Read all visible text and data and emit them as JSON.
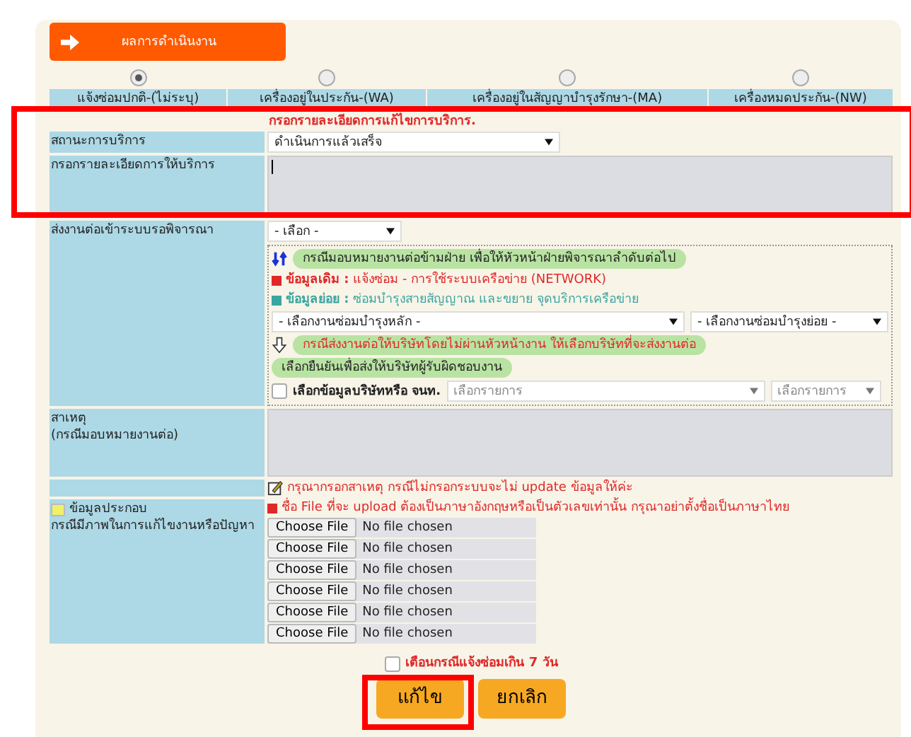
{
  "header_tab": {
    "label": "ผลการดำเนินงาน"
  },
  "service_types": [
    {
      "label": "แจ้งซ่อมปกติ-(ไม่ระบุ)",
      "selected": true
    },
    {
      "label": "เครื่องอยู่ในประกัน-(WA)",
      "selected": false
    },
    {
      "label": "เครื่องอยู่ในสัญญาบำรุงรักษา-(MA)",
      "selected": false
    },
    {
      "label": "เครื่องหมดประกัน-(NW)",
      "selected": false
    }
  ],
  "service_detail": {
    "highlighted": true,
    "title": "กรอกรายละเอียดการแก้ไขการบริการ.",
    "status_label": "สถานะการบริการ",
    "status_value": "ดำเนินการแล้วเสร็จ",
    "details_label": "กรอกรายละเอียดการให้บริการ"
  },
  "forward": {
    "label": "ส่งงานต่อเข้าระบบรอพิจารณา",
    "select": "- เลือก -",
    "transfer_note": "กรณีมอบหมายงานต่อข้ามฝ่าย เพื่อให้หัวหน้าฝ่ายพิจารณาลำดับต่อไป",
    "info": [
      {
        "label": "ข้อมูลเดิม :",
        "value": "แจ้งซ่อม - การใช้ระบบเครือข่าย (NETWORK)",
        "color": "#e02828"
      },
      {
        "label": "ข้อมูลย่อย :",
        "value": "ซ่อมบำรุงสายสัญญาณ และขยาย จุดบริการเครือข่าย",
        "color": "#3aa6a0"
      }
    ],
    "main_select": "- เลือกงานซ่อมบำรุงหลัก -",
    "sub_select": "- เลือกงานซ่อมบำรุงย่อย -",
    "company_note": "กรณีส่งงานต่อให้บริษัทโดยไม่ผ่านหัวหน้างาน ให้เลือกบริษัทที่จะส่งงานต่อ",
    "confirm_note": "เลือกยืนยันเพื่อส่งให้บริษัทผู้รับผิดชอบงาน",
    "company_checkbox": {
      "label": "เลือกข้อมูลบริษัทหรือ จนท.",
      "checked": false
    },
    "company_select": {
      "placeholder": "เลือกรายการ"
    },
    "item_select": {
      "placeholder": "เลือกรายการ"
    }
  },
  "reason": {
    "label": "สาเหตุ",
    "sublabel": "(กรณีมอบหมายงานต่อ)",
    "note": "กรุณากรอกสาเหตุ กรณีไม่กรอกระบบจะไม่ update ข้อมูลให้ค่ะ"
  },
  "attachments": {
    "label": "ข้อมูลประกอบ",
    "sublabel": "กรณีมีภาพในการแก้ไขงานหรือปัญหา",
    "note": "ชื่อ File ที่จะ upload ต้องเป็นภาษาอังกฤษหรือเป็นตัวเลขเท่านั้น กรุณาอย่าตั้งชื่อเป็นภาษาไทย",
    "files": [
      {
        "button": "Choose File",
        "status": "No file chosen"
      },
      {
        "button": "Choose File",
        "status": "No file chosen"
      },
      {
        "button": "Choose File",
        "status": "No file chosen"
      },
      {
        "button": "Choose File",
        "status": "No file chosen"
      },
      {
        "button": "Choose File",
        "status": "No file chosen"
      },
      {
        "button": "Choose File",
        "status": "No file chosen"
      }
    ]
  },
  "overdue_warning": {
    "label": "เตือนกรณีแจ้งซ่อมเกิน 7 วัน",
    "checked": false
  },
  "buttons": [
    {
      "label": "แก้ไข",
      "highlighted": true
    },
    {
      "label": "ยกเลิก",
      "highlighted": false
    }
  ]
}
